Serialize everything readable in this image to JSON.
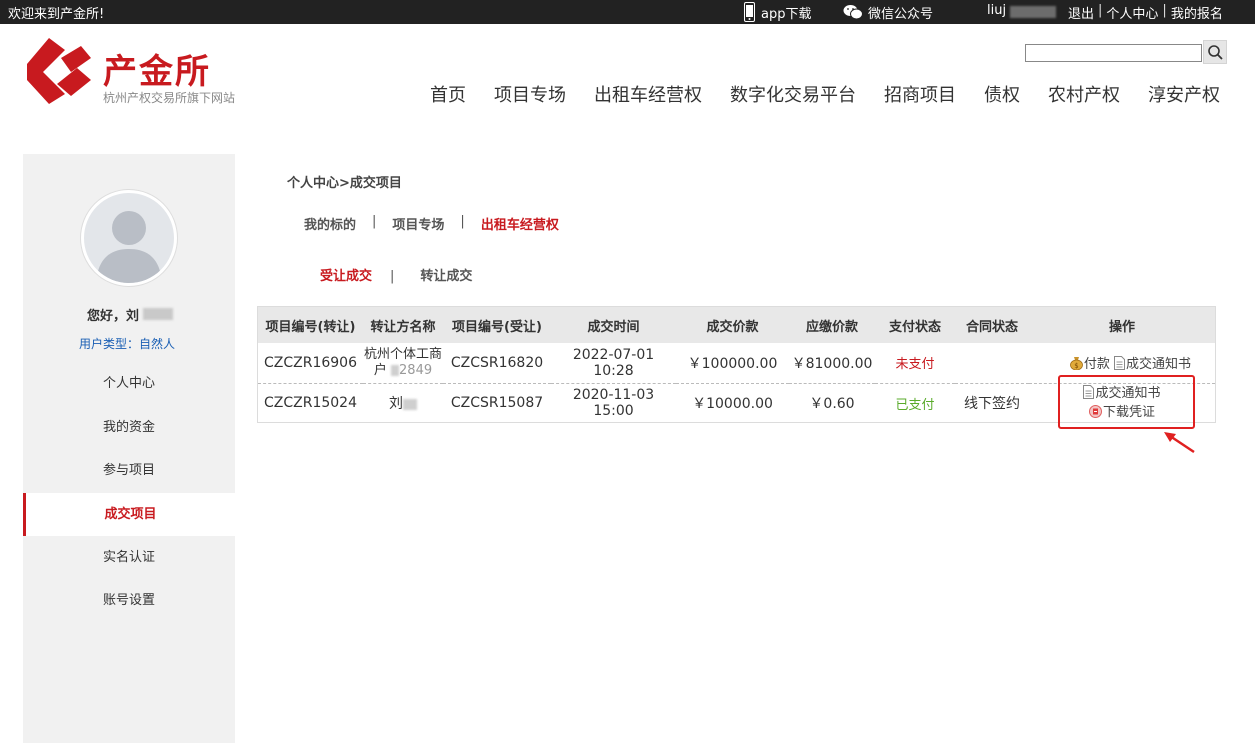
{
  "topbar": {
    "welcome": "欢迎来到产金所!",
    "app_download": "app下载",
    "wechat": "微信公众号",
    "user": "liuj",
    "logout": "退出",
    "sep": "|",
    "personal_center": "个人中心",
    "my_signup": "我的报名"
  },
  "header": {
    "brand": "产金所",
    "subtitle": "杭州产权交易所旗下网站",
    "search_placeholder": "",
    "nav": [
      "首页",
      "项目专场",
      "出租车经营权",
      "数字化交易平台",
      "招商项目",
      "债权",
      "农村产权",
      "淳安产权"
    ]
  },
  "sidebar": {
    "hello": "您好，刘",
    "user_type": "用户类型：自然人",
    "menu": [
      "个人中心",
      "我的资金",
      "参与项目",
      "成交项目",
      "实名认证",
      "账号设置"
    ],
    "active": "成交项目"
  },
  "content": {
    "breadcrumb": "个人中心>成交项目",
    "tabs1": [
      "我的标的",
      "项目专场",
      "出租车经营权"
    ],
    "tabs1_sep": "|",
    "tabs2": [
      "受让成交",
      "转让成交"
    ],
    "table": {
      "headers": [
        "项目编号(转让)",
        "转让方名称",
        "项目编号(受让)",
        "成交时间",
        "成交价款",
        "应缴价款",
        "支付状态",
        "合同状态",
        "操作"
      ],
      "rows": [
        {
          "transfer_no": "CZCZR16906",
          "transferor_line1": "杭州个体工商",
          "transferor_line2": "户",
          "transferor_tail": "2849",
          "receive_no": "CZCSR16820",
          "time": "2022-07-01 10:28",
          "price": "￥100000.00",
          "due": "￥81000.00",
          "pay_status": "未支付",
          "contract_status": "",
          "ops": [
            "付款",
            "成交通知书"
          ]
        },
        {
          "transfer_no": "CZCZR15024",
          "transferor_line1": "刘",
          "transferor_line2": "",
          "transferor_tail": "",
          "receive_no": "CZCSR15087",
          "time": "2020-11-03 15:00",
          "price": "￥10000.00",
          "due": "￥0.60",
          "pay_status": "已支付",
          "contract_status": "线下签约",
          "ops": [
            "成交通知书",
            "下载凭证"
          ]
        }
      ]
    }
  },
  "colors": {
    "brand_red": "#c81a1f",
    "paid_green": "#5aab2b",
    "link_blue": "#1a5fb4",
    "highlight_red": "#e02020"
  }
}
